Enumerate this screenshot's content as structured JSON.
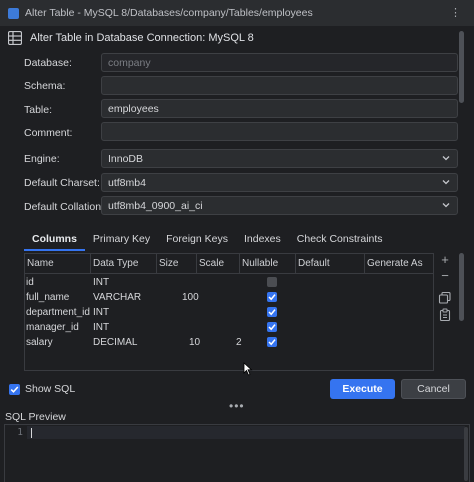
{
  "titlebar": {
    "title": "Alter Table - MySQL 8/Databases/company/Tables/employees",
    "more_icon": "more-dots-icon"
  },
  "header": {
    "title": "Alter Table in Database Connection: MySQL 8",
    "icon": "table-grid-icon"
  },
  "form": {
    "database_label": "Database:",
    "database_value": "company",
    "schema_label": "Schema:",
    "schema_value": "",
    "table_label": "Table:",
    "table_value": "employees",
    "comment_label": "Comment:",
    "comment_value": "",
    "engine_label": "Engine:",
    "engine_value": "InnoDB",
    "charset_label": "Default Charset:",
    "charset_value": "utf8mb4",
    "collation_label": "Default Collation:",
    "collation_value": "utf8mb4_0900_ai_ci"
  },
  "tabs": [
    {
      "label": "Columns",
      "active": true
    },
    {
      "label": "Primary Key",
      "active": false
    },
    {
      "label": "Foreign Keys",
      "active": false
    },
    {
      "label": "Indexes",
      "active": false
    },
    {
      "label": "Check Constraints",
      "active": false
    }
  ],
  "columns_table": {
    "headers": [
      "Name",
      "Data Type",
      "Size",
      "Scale",
      "Nullable",
      "Default",
      "Generate As"
    ],
    "rows": [
      {
        "name": "id",
        "type": "INT",
        "size": "",
        "scale": "",
        "nullable": false
      },
      {
        "name": "full_name",
        "type": "VARCHAR",
        "size": "100",
        "scale": "",
        "nullable": true
      },
      {
        "name": "department_id",
        "type": "INT",
        "size": "",
        "scale": "",
        "nullable": true
      },
      {
        "name": "manager_id",
        "type": "INT",
        "size": "",
        "scale": "",
        "nullable": true
      },
      {
        "name": "salary",
        "type": "DECIMAL",
        "size": "10",
        "scale": "2",
        "nullable": true
      }
    ]
  },
  "side_tools": {
    "add": "+",
    "remove": "−"
  },
  "footer": {
    "show_sql_label": "Show SQL",
    "show_sql_checked": true,
    "execute_label": "Execute",
    "cancel_label": "Cancel",
    "splitter": "•••"
  },
  "sql_preview": {
    "label": "SQL Preview",
    "line_number": "1",
    "content": ""
  },
  "colors": {
    "accent": "#3574f0",
    "background": "#1e1f22",
    "panel": "#2b2d30"
  }
}
